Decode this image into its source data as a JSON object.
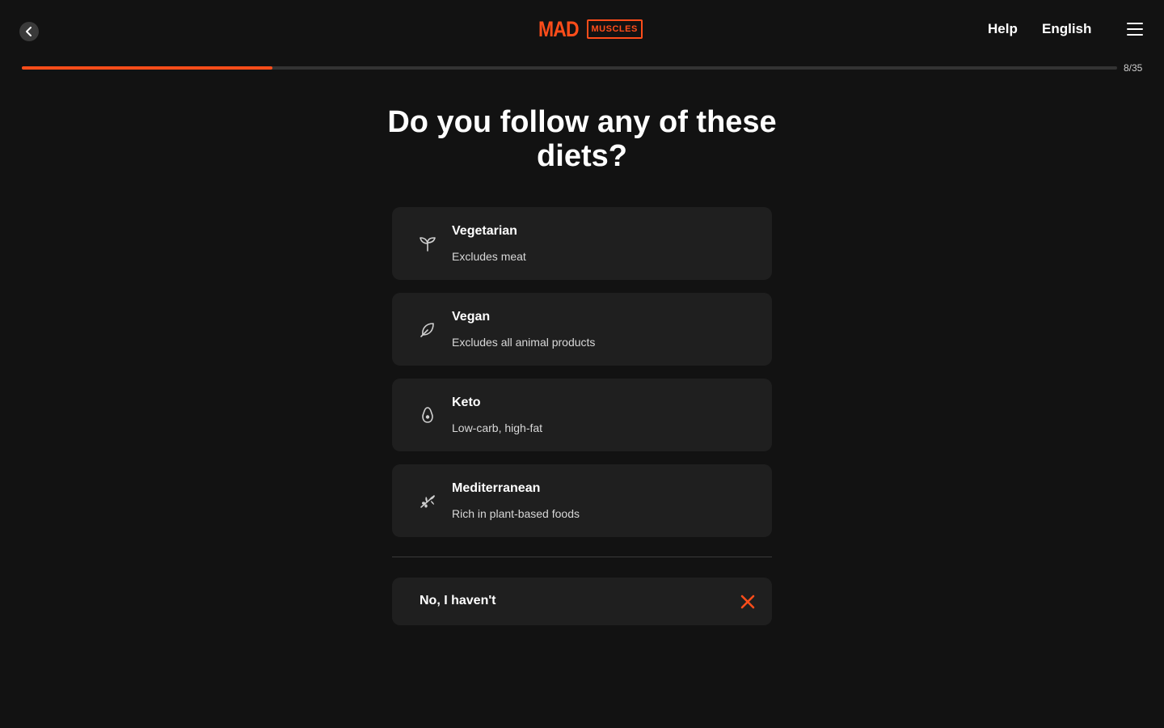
{
  "header": {
    "logo_main": "MAD",
    "logo_box": "MUSCLES",
    "help_label": "Help",
    "language_label": "English"
  },
  "progress": {
    "current": 8,
    "total": 35,
    "label": "8/35",
    "fraction": 0.229,
    "accent_color": "#ff4d1a"
  },
  "question": {
    "title": "Do you follow any of these diets?"
  },
  "options": [
    {
      "title": "Vegetarian",
      "subtitle": "Excludes meat",
      "icon": "sprout-icon"
    },
    {
      "title": "Vegan",
      "subtitle": "Excludes all animal products",
      "icon": "leaf-icon"
    },
    {
      "title": "Keto",
      "subtitle": "Low-carb, high-fat",
      "icon": "avocado-icon"
    },
    {
      "title": "Mediterranean",
      "subtitle": "Rich in plant-based foods",
      "icon": "olive-branch-icon"
    }
  ],
  "none_option": {
    "label": "No, I haven't",
    "icon": "close-icon"
  },
  "colors": {
    "background": "#121212",
    "card": "#1f1f1f",
    "accent": "#ff4d1a"
  }
}
